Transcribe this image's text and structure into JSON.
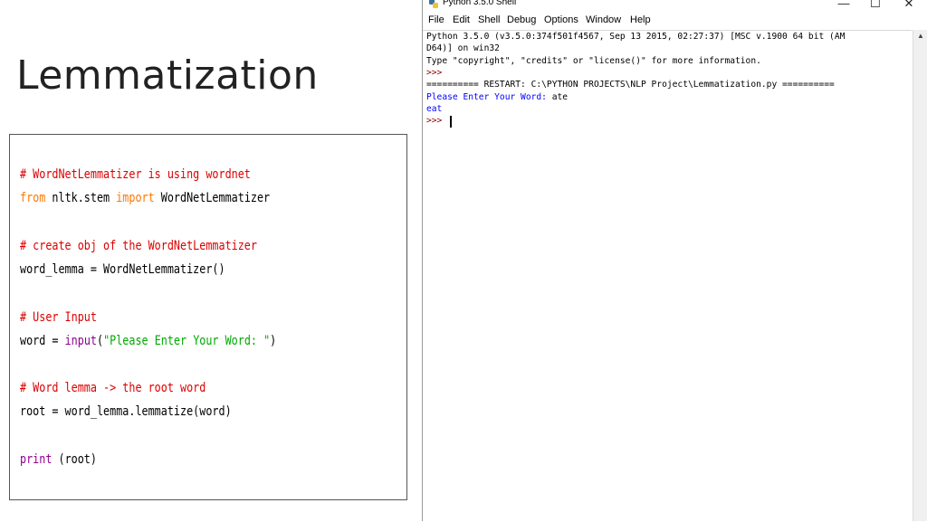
{
  "slide": {
    "title": "Lemmatization"
  },
  "code": {
    "lines": [
      {
        "segments": [
          {
            "text": "# WordNetLemmatizer is using wordnet",
            "kind": "comment"
          }
        ]
      },
      {
        "segments": [
          {
            "text": "from",
            "kind": "kw"
          },
          {
            "text": " nltk.stem ",
            "kind": "plain"
          },
          {
            "text": "import",
            "kind": "kw"
          },
          {
            "text": " WordNetLemmatizer",
            "kind": "plain"
          }
        ]
      },
      {
        "segments": [
          {
            "text": "# create obj of the WordNetLemmatizer",
            "kind": "comment"
          }
        ]
      },
      {
        "segments": [
          {
            "text": "word_lemma = WordNetLemmatizer()",
            "kind": "plain"
          }
        ]
      },
      {
        "segments": [
          {
            "text": "# User Input",
            "kind": "comment"
          }
        ]
      },
      {
        "segments": [
          {
            "text": "word = ",
            "kind": "plain"
          },
          {
            "text": "input",
            "kind": "builtin"
          },
          {
            "text": "(",
            "kind": "plain"
          },
          {
            "text": "\"Please Enter Your Word: \"",
            "kind": "string"
          },
          {
            "text": ")",
            "kind": "plain"
          }
        ]
      },
      {
        "segments": [
          {
            "text": "# Word lemma -> the root word",
            "kind": "comment"
          }
        ]
      },
      {
        "segments": [
          {
            "text": "root = word_lemma.lemmatize(word)",
            "kind": "plain"
          }
        ]
      },
      {
        "segments": [
          {
            "text": "print",
            "kind": "builtin"
          },
          {
            "text": " (root)",
            "kind": "plain"
          }
        ]
      }
    ]
  },
  "idle": {
    "window_title": "Python 3.5.0 Shell",
    "menu": [
      "File",
      "Edit",
      "Shell",
      "Debug",
      "Options",
      "Window",
      "Help"
    ],
    "controls": {
      "minimize": "—",
      "maximize": "☐",
      "close": "✕"
    },
    "shell_lines": [
      {
        "text": "Python 3.5.0 (v3.5.0:374f501f4567, Sep 13 2015, 02:27:37) [MSC v.1900 64 bit (AM",
        "kind": "plain"
      },
      {
        "text": "D64)] on win32",
        "kind": "plain"
      },
      {
        "text": "Type \"copyright\", \"credits\" or \"license()\" for more information.",
        "kind": "plain"
      },
      {
        "text": ">>>",
        "kind": "prompt"
      },
      {
        "text": "========== RESTART: C:\\PYTHON PROJECTS\\NLP Project\\Lemmatization.py ==========",
        "kind": "plain"
      },
      {
        "text": "Please Enter Your Word: ",
        "kind": "out",
        "input": "ate"
      },
      {
        "text": "eat",
        "kind": "out"
      },
      {
        "text": ">>> ",
        "kind": "prompt"
      }
    ],
    "scroll_up_icon": "▲"
  },
  "colors": {
    "comment": "#dd0000",
    "keyword": "#ff7700",
    "builtin": "#900090",
    "string": "#00aa00",
    "shell_output": "#0000ff",
    "prompt": "#8b0000"
  }
}
